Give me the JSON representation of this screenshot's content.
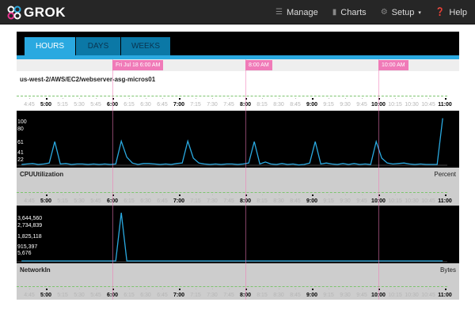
{
  "app": {
    "name": "GROK"
  },
  "nav": [
    {
      "label": "Manage",
      "icon": "list-icon"
    },
    {
      "label": "Charts",
      "icon": "bar-chart-icon"
    },
    {
      "label": "Setup",
      "icon": "gear-icon",
      "caret": "▾"
    },
    {
      "label": "Help",
      "icon": "help-icon"
    }
  ],
  "tabs": [
    {
      "label": "HOURS",
      "active": true
    },
    {
      "label": "DAYS"
    },
    {
      "label": "WEEKS"
    }
  ],
  "markers": [
    {
      "label": "Fri Jul 18 6:00 AM",
      "minute": 360
    },
    {
      "label": "8:00 AM",
      "minute": 480
    },
    {
      "label": "10:00 AM",
      "minute": 600
    }
  ],
  "instance": "us-west-2/AWS/EC2/webserver-asg-micros01",
  "axis_ticks": [
    "4:45",
    "5:00",
    "5:15",
    "5:30",
    "5:45",
    "6:00",
    "6:15",
    "6:30",
    "6:45",
    "7:00",
    "7:15",
    "7:30",
    "7:45",
    "8:00",
    "8:15",
    "8:30",
    "8:45",
    "9:00",
    "9:15",
    "9:30",
    "9:45",
    "10:00",
    "10:15",
    "10:30",
    "10:45",
    "11:00"
  ],
  "chart_data": [
    {
      "type": "line",
      "title": "CPUUtilization",
      "unit": "Percent",
      "y_labels": [
        "100",
        "80",
        "61",
        "41",
        "22"
      ],
      "color": "#2aa9e0",
      "x_start": "4:38",
      "x_step_minutes": 5,
      "values": [
        15,
        16,
        17,
        15,
        16,
        18,
        62,
        16,
        17,
        15,
        16,
        16,
        15,
        16,
        15,
        16,
        15,
        16,
        63,
        30,
        18,
        15,
        17,
        17,
        16,
        15,
        16,
        15,
        17,
        18,
        63,
        28,
        18,
        16,
        15,
        16,
        15,
        16,
        16,
        15,
        16,
        18,
        62,
        16,
        20,
        16,
        15,
        17,
        15,
        16,
        14,
        15,
        18,
        62,
        16,
        18,
        16,
        15,
        17,
        15,
        17,
        15,
        16,
        15,
        62,
        28,
        18,
        16,
        17,
        18,
        16,
        15,
        16,
        15,
        15,
        15,
        110
      ]
    },
    {
      "type": "line",
      "title": "NetworkIn",
      "unit": "Bytes",
      "y_labels": [
        "3,644,560",
        "2,734,839",
        "1,825,118",
        "915,397",
        "5,676"
      ],
      "color": "#2aa9e0",
      "x_start": "4:38",
      "x_step_minutes": 5,
      "values": [
        5676,
        6000,
        6500,
        5800,
        5900,
        6100,
        6200,
        6000,
        5700,
        6000,
        6500,
        6200,
        6000,
        5900,
        5700,
        6000,
        5800,
        6000,
        3900000,
        6000,
        6000,
        5900,
        6100,
        6000,
        5900,
        6200,
        6000,
        6400,
        6100,
        5900,
        6000,
        6300,
        6000,
        6200,
        6000,
        5900,
        6100,
        6000,
        6200,
        6500,
        6300,
        6000,
        6100,
        6200,
        6000,
        6300,
        6000,
        5900,
        6000,
        6100,
        6200,
        6000,
        6400,
        6700,
        6200,
        6100,
        6000,
        6300,
        6000,
        6100,
        6000,
        6200,
        6000,
        6100,
        6200,
        6600,
        6300,
        6100,
        6000,
        6200,
        6000,
        6100,
        6300,
        6000,
        6100,
        6000,
        6200
      ]
    }
  ]
}
